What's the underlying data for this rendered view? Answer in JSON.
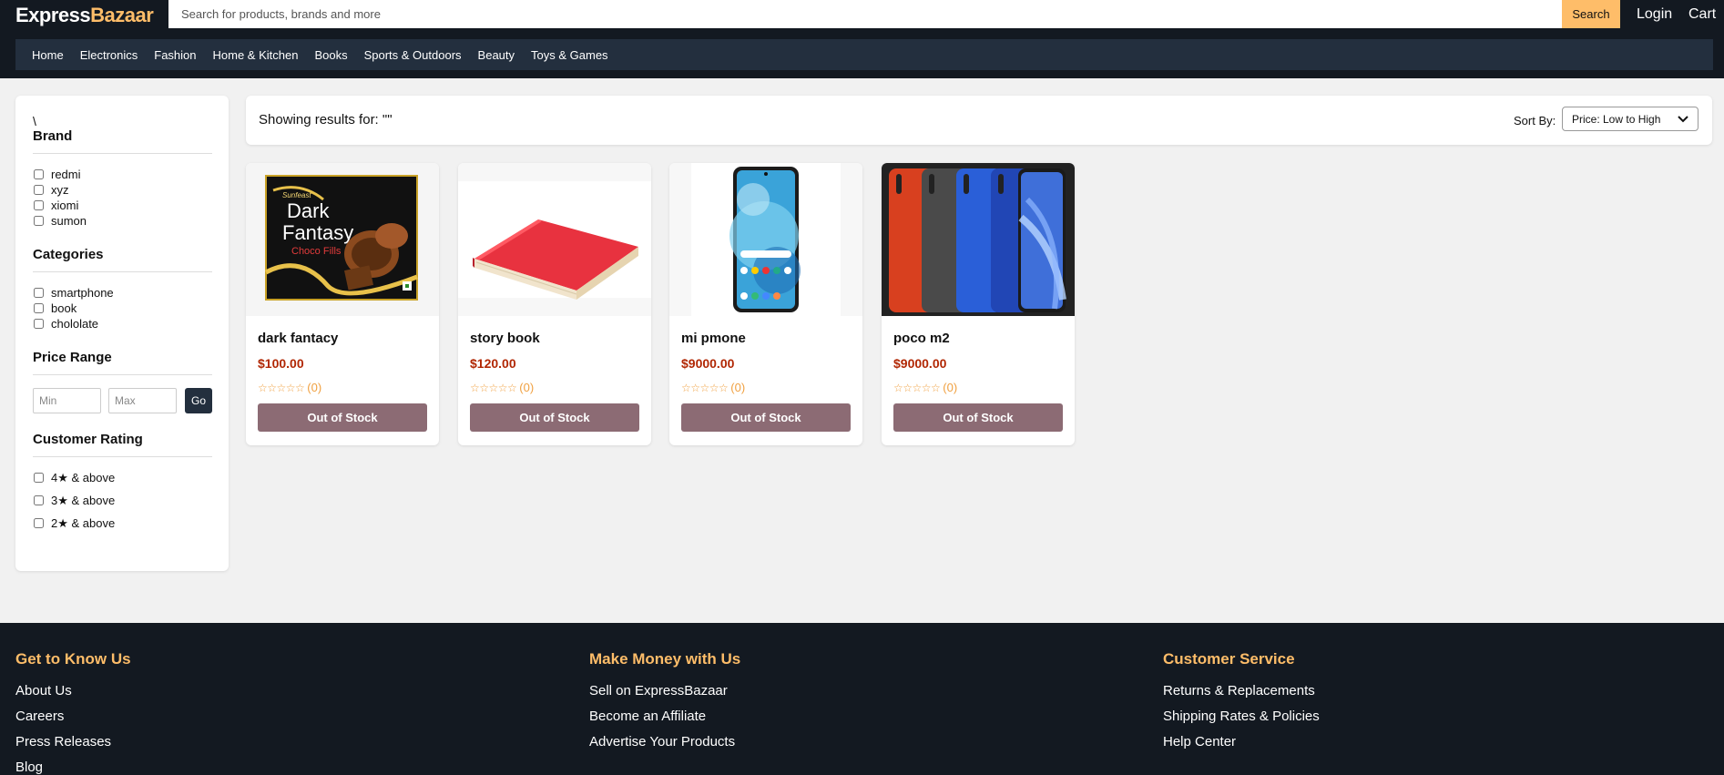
{
  "header": {
    "logo_part1": "Express",
    "logo_part2": "Bazaar",
    "search_placeholder": "Search for products, brands and more",
    "search_button": "Search",
    "login": "Login",
    "cart": "Cart"
  },
  "nav": {
    "items": [
      "Home",
      "Electronics",
      "Fashion",
      "Home & Kitchen",
      "Books",
      "Sports & Outdoors",
      "Beauty",
      "Toys & Games"
    ]
  },
  "sidebar": {
    "stray_text": "\\",
    "brand": {
      "title": "Brand",
      "options": [
        "redmi",
        "xyz",
        "xiomi",
        "sumon"
      ]
    },
    "categories": {
      "title": "Categories",
      "options": [
        "smartphone",
        "book",
        "chololate"
      ]
    },
    "price": {
      "title": "Price Range",
      "min_placeholder": "Min",
      "max_placeholder": "Max",
      "go": "Go"
    },
    "rating": {
      "title": "Customer Rating",
      "options": [
        "4★ & above",
        "3★ & above",
        "2★ & above"
      ]
    }
  },
  "results": {
    "showing_text": "Showing results for: \"\"",
    "sort_label": "Sort By:",
    "sort_value": "Price: Low to High"
  },
  "products": [
    {
      "name": "dark fantacy",
      "price": "$100.00",
      "stars": "☆☆☆☆☆",
      "count": "(0)",
      "button": "Out of Stock",
      "image": "chocolate-box"
    },
    {
      "name": "story book",
      "price": "$120.00",
      "stars": "☆☆☆☆☆",
      "count": "(0)",
      "button": "Out of Stock",
      "image": "red-book"
    },
    {
      "name": "mi pmone",
      "price": "$9000.00",
      "stars": "☆☆☆☆☆",
      "count": "(0)",
      "button": "Out of Stock",
      "image": "smartphone"
    },
    {
      "name": "poco m2",
      "price": "$9000.00",
      "stars": "☆☆☆☆☆",
      "count": "(0)",
      "button": "Out of Stock",
      "image": "four-phones"
    }
  ],
  "product_image_text": {
    "brand_mark": "Sunfeast",
    "product_line1": "Dark",
    "product_line2": "Fantasy",
    "product_line3": "Choco Fills"
  },
  "footer": {
    "col1": {
      "title": "Get to Know Us",
      "links": [
        "About Us",
        "Careers",
        "Press Releases",
        "Blog"
      ]
    },
    "col2": {
      "title": "Make Money with Us",
      "links": [
        "Sell on ExpressBazaar",
        "Become an Affiliate",
        "Advertise Your Products"
      ]
    },
    "col3": {
      "title": "Customer Service",
      "links": [
        "Returns & Replacements",
        "Shipping Rates & Policies",
        "Help Center"
      ]
    }
  },
  "colors": {
    "header_bg": "#131921",
    "nav_bg": "#232f3e",
    "accent": "#febd69",
    "price": "#b12704",
    "out_of_stock_button": "#8c6b74"
  }
}
